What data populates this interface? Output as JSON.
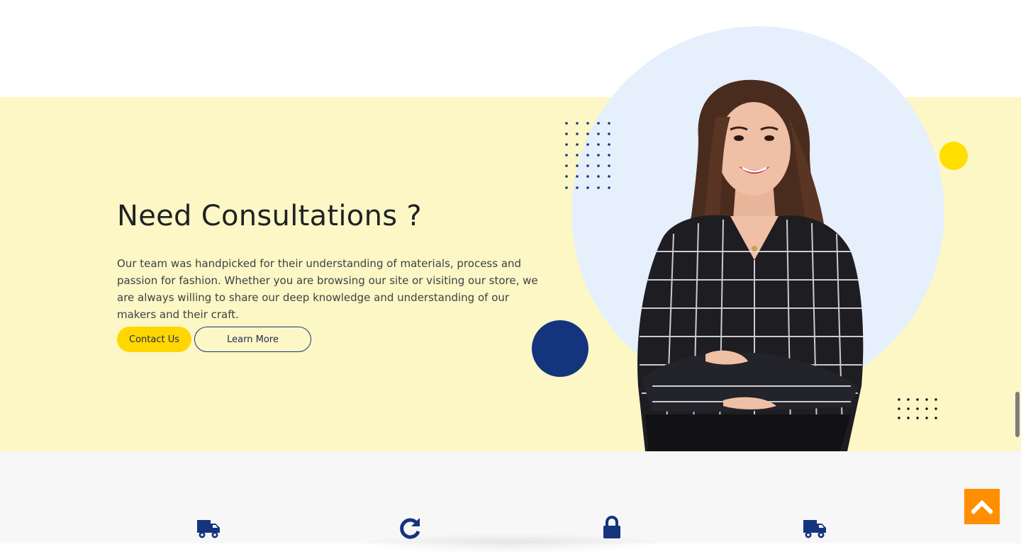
{
  "hero": {
    "title": "Need Consultations ?",
    "description": "Our team was handpicked for their understanding of materials, process and passion for fashion. Whether you are browsing our site or visiting our store, we are always willing to share our deep knowledge and understanding of our makers and their craft.",
    "contact_label": "Contact Us",
    "learn_label": "Learn More"
  },
  "features": {
    "icons": [
      "truck-icon",
      "refresh-icon",
      "lock-icon",
      "truck-icon"
    ]
  },
  "colors": {
    "hero_bg": "#fdf7c5",
    "accent_yellow": "#ffd700",
    "navy": "#15347e",
    "light_blue": "#e6effc",
    "scroll_top": "#ff8f00",
    "features_bg": "#f7f7f7"
  },
  "scroll_top": {
    "icon": "chevron-up-icon"
  }
}
